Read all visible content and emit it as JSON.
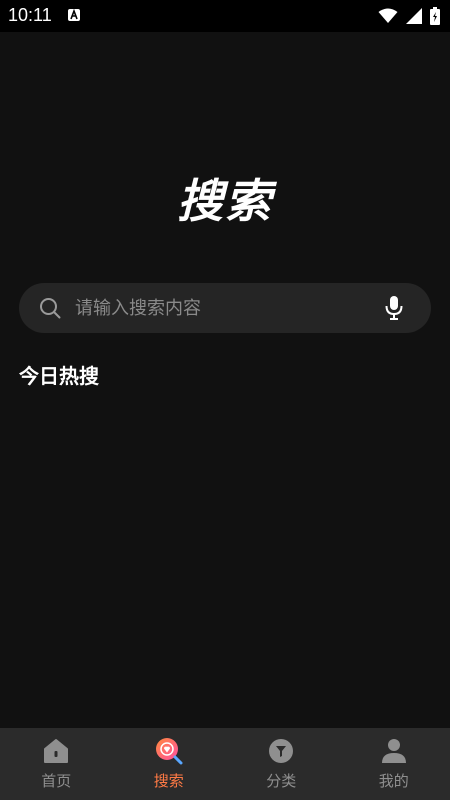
{
  "status_bar": {
    "time": "10:11"
  },
  "page": {
    "title": "搜索"
  },
  "search": {
    "placeholder": "请输入搜索内容",
    "value": ""
  },
  "hot_search": {
    "heading": "今日热搜"
  },
  "bottom_nav": {
    "items": [
      {
        "label": "首页",
        "icon": "home-icon",
        "active": false
      },
      {
        "label": "搜索",
        "icon": "search-tab-icon",
        "active": true
      },
      {
        "label": "分类",
        "icon": "category-icon",
        "active": false
      },
      {
        "label": "我的",
        "icon": "profile-icon",
        "active": false
      }
    ]
  },
  "colors": {
    "background": "#111111",
    "search_bar": "#252525",
    "nav_background": "#2b2b2b",
    "accent": "#ff7a45",
    "inactive": "#8f8f8f"
  }
}
